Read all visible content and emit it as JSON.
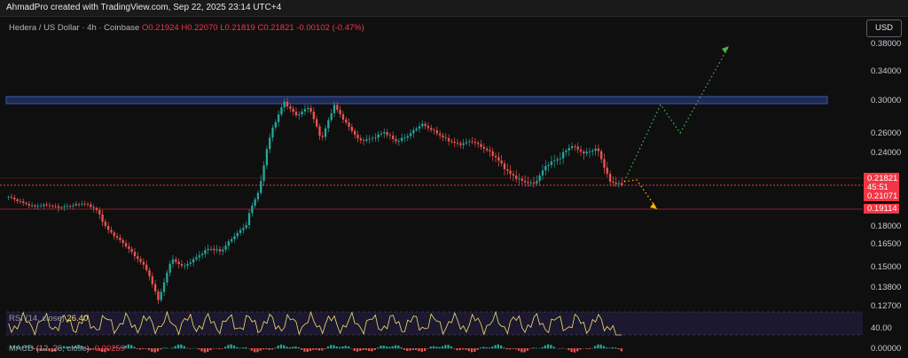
{
  "header": {
    "credit": "AhmadPro created with TradingView.com, Sep 22, 2025 23:14 UTC+4"
  },
  "symbol": {
    "name": "Hedera / US Dollar · 4h · Coinbase",
    "open": "O0.21924",
    "high": "H0.22070",
    "low": "L0.21819",
    "close": "C0.21821",
    "change": "-0.00102 (-0.47%)"
  },
  "currency": "USD",
  "price_axis": {
    "labels": [
      "0.38000",
      "0.34000",
      "0.30000",
      "0.26000",
      "0.24000",
      "0.18000",
      "0.16500",
      "0.15000",
      "0.13800",
      "0.12700"
    ]
  },
  "price_tags": {
    "current": "0.21821",
    "countdown": "45:51",
    "level_mid": "0.21071",
    "level_low": "0.19114"
  },
  "rsi": {
    "label": "RSI (14, close)",
    "value": "26.40",
    "axis_label": "40.00"
  },
  "macd": {
    "label": "MACD (12, 26, close)",
    "value": "-0.00259",
    "axis_label": "0.00000"
  },
  "colors": {
    "up": "#26a69a",
    "down": "#ef5350",
    "resistance_zone": "#1c2a54",
    "level_line": "#f23645",
    "projection_up": "#4caf50",
    "projection_down": "#ffb300",
    "rsi_line": "#f7e16b"
  },
  "chart_data": {
    "type": "candlestick",
    "symbol": "Hedera / US Dollar",
    "timeframe": "4h",
    "close": [
      0.205,
      0.199,
      0.194,
      0.196,
      0.193,
      0.195,
      0.198,
      0.191,
      0.176,
      0.167,
      0.158,
      0.149,
      0.13,
      0.155,
      0.15,
      0.156,
      0.162,
      0.16,
      0.171,
      0.181,
      0.212,
      0.262,
      0.298,
      0.281,
      0.292,
      0.252,
      0.294,
      0.271,
      0.252,
      0.254,
      0.261,
      0.251,
      0.258,
      0.271,
      0.262,
      0.253,
      0.248,
      0.252,
      0.244,
      0.236,
      0.226,
      0.221,
      0.219,
      0.232,
      0.236,
      0.247,
      0.239,
      0.244,
      0.221,
      0.218
    ],
    "resistance_zone": [
      0.3,
      0.306
    ],
    "levels": [
      0.21821,
      0.21071,
      0.19114
    ],
    "projection_bullish": [
      0.2182,
      0.3,
      0.266,
      0.375
    ],
    "projection_bearish": [
      0.2182,
      0.214,
      0.191
    ]
  }
}
